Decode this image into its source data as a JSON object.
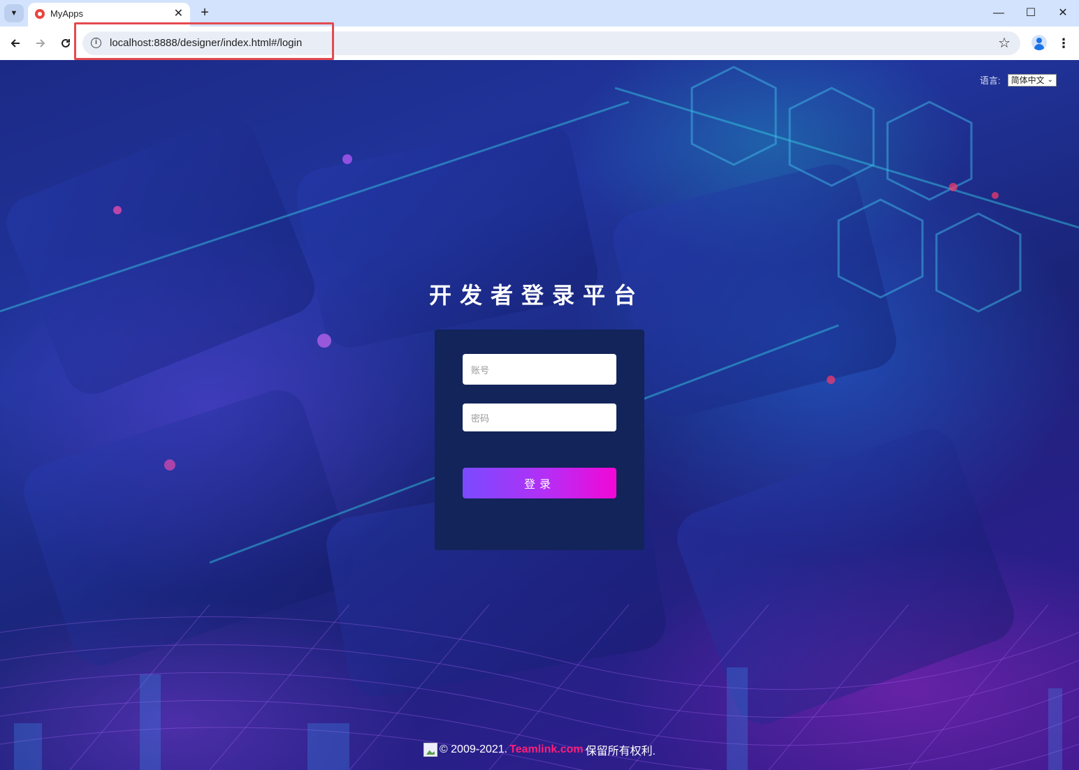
{
  "browser": {
    "tab_title": "MyApps",
    "tab_close": "✕",
    "new_tab": "+",
    "url": "localhost:8888/designer/index.html#/login",
    "window_minimize": "—",
    "window_maximize": "☐",
    "window_close": "✕"
  },
  "page": {
    "language_label": "语言:",
    "language_selected": "简体中文",
    "title": "开发者登录平台",
    "account_placeholder": "账号",
    "password_placeholder": "密码",
    "login_button": "登录",
    "footer_prefix": "© 2009-2021.",
    "footer_link": "Teamlink.com",
    "footer_suffix": " 保留所有权利."
  },
  "colors": {
    "panel": "#122459",
    "button_start": "#7a4bff",
    "button_end": "#f207d6",
    "footer_link": "#ff1e78",
    "highlight": "#e44a4f"
  }
}
